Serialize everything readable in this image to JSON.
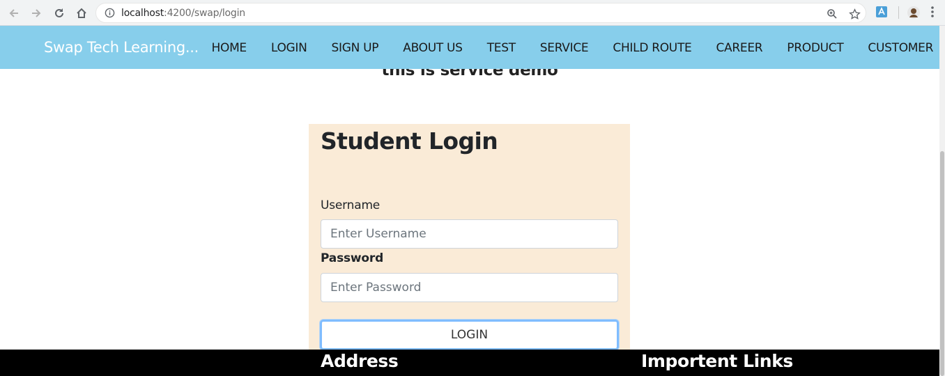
{
  "browser": {
    "url_host": "localhost",
    "url_path": ":4200/swap/login",
    "icons": [
      "back-arrow-icon",
      "forward-arrow-icon",
      "reload-icon",
      "home-icon",
      "info-icon",
      "zoom-icon",
      "star-icon",
      "extension-icon",
      "profile-avatar",
      "menu-dots-icon"
    ]
  },
  "navbar": {
    "brand": "Swap Tech Learning...",
    "items": [
      {
        "label": "HOME"
      },
      {
        "label": "LOGIN"
      },
      {
        "label": "SIGN UP"
      },
      {
        "label": "ABOUT US"
      },
      {
        "label": "TEST"
      },
      {
        "label": "SERVICE"
      },
      {
        "label": "CHILD ROUTE"
      },
      {
        "label": "CAREER"
      },
      {
        "label": "PRODUCT"
      },
      {
        "label": "CUSTOMER"
      }
    ],
    "background": "#87ceeb"
  },
  "service_text": "this is service demo",
  "login": {
    "title": "Student Login",
    "username_label": "Username",
    "username_placeholder": "Enter Username",
    "password_label": "Password",
    "password_placeholder": "Enter Password",
    "button_label": "LOGIN",
    "card_background": "#faebd7"
  },
  "footer": {
    "address_heading": "Address",
    "links_heading": "Importent Links"
  }
}
